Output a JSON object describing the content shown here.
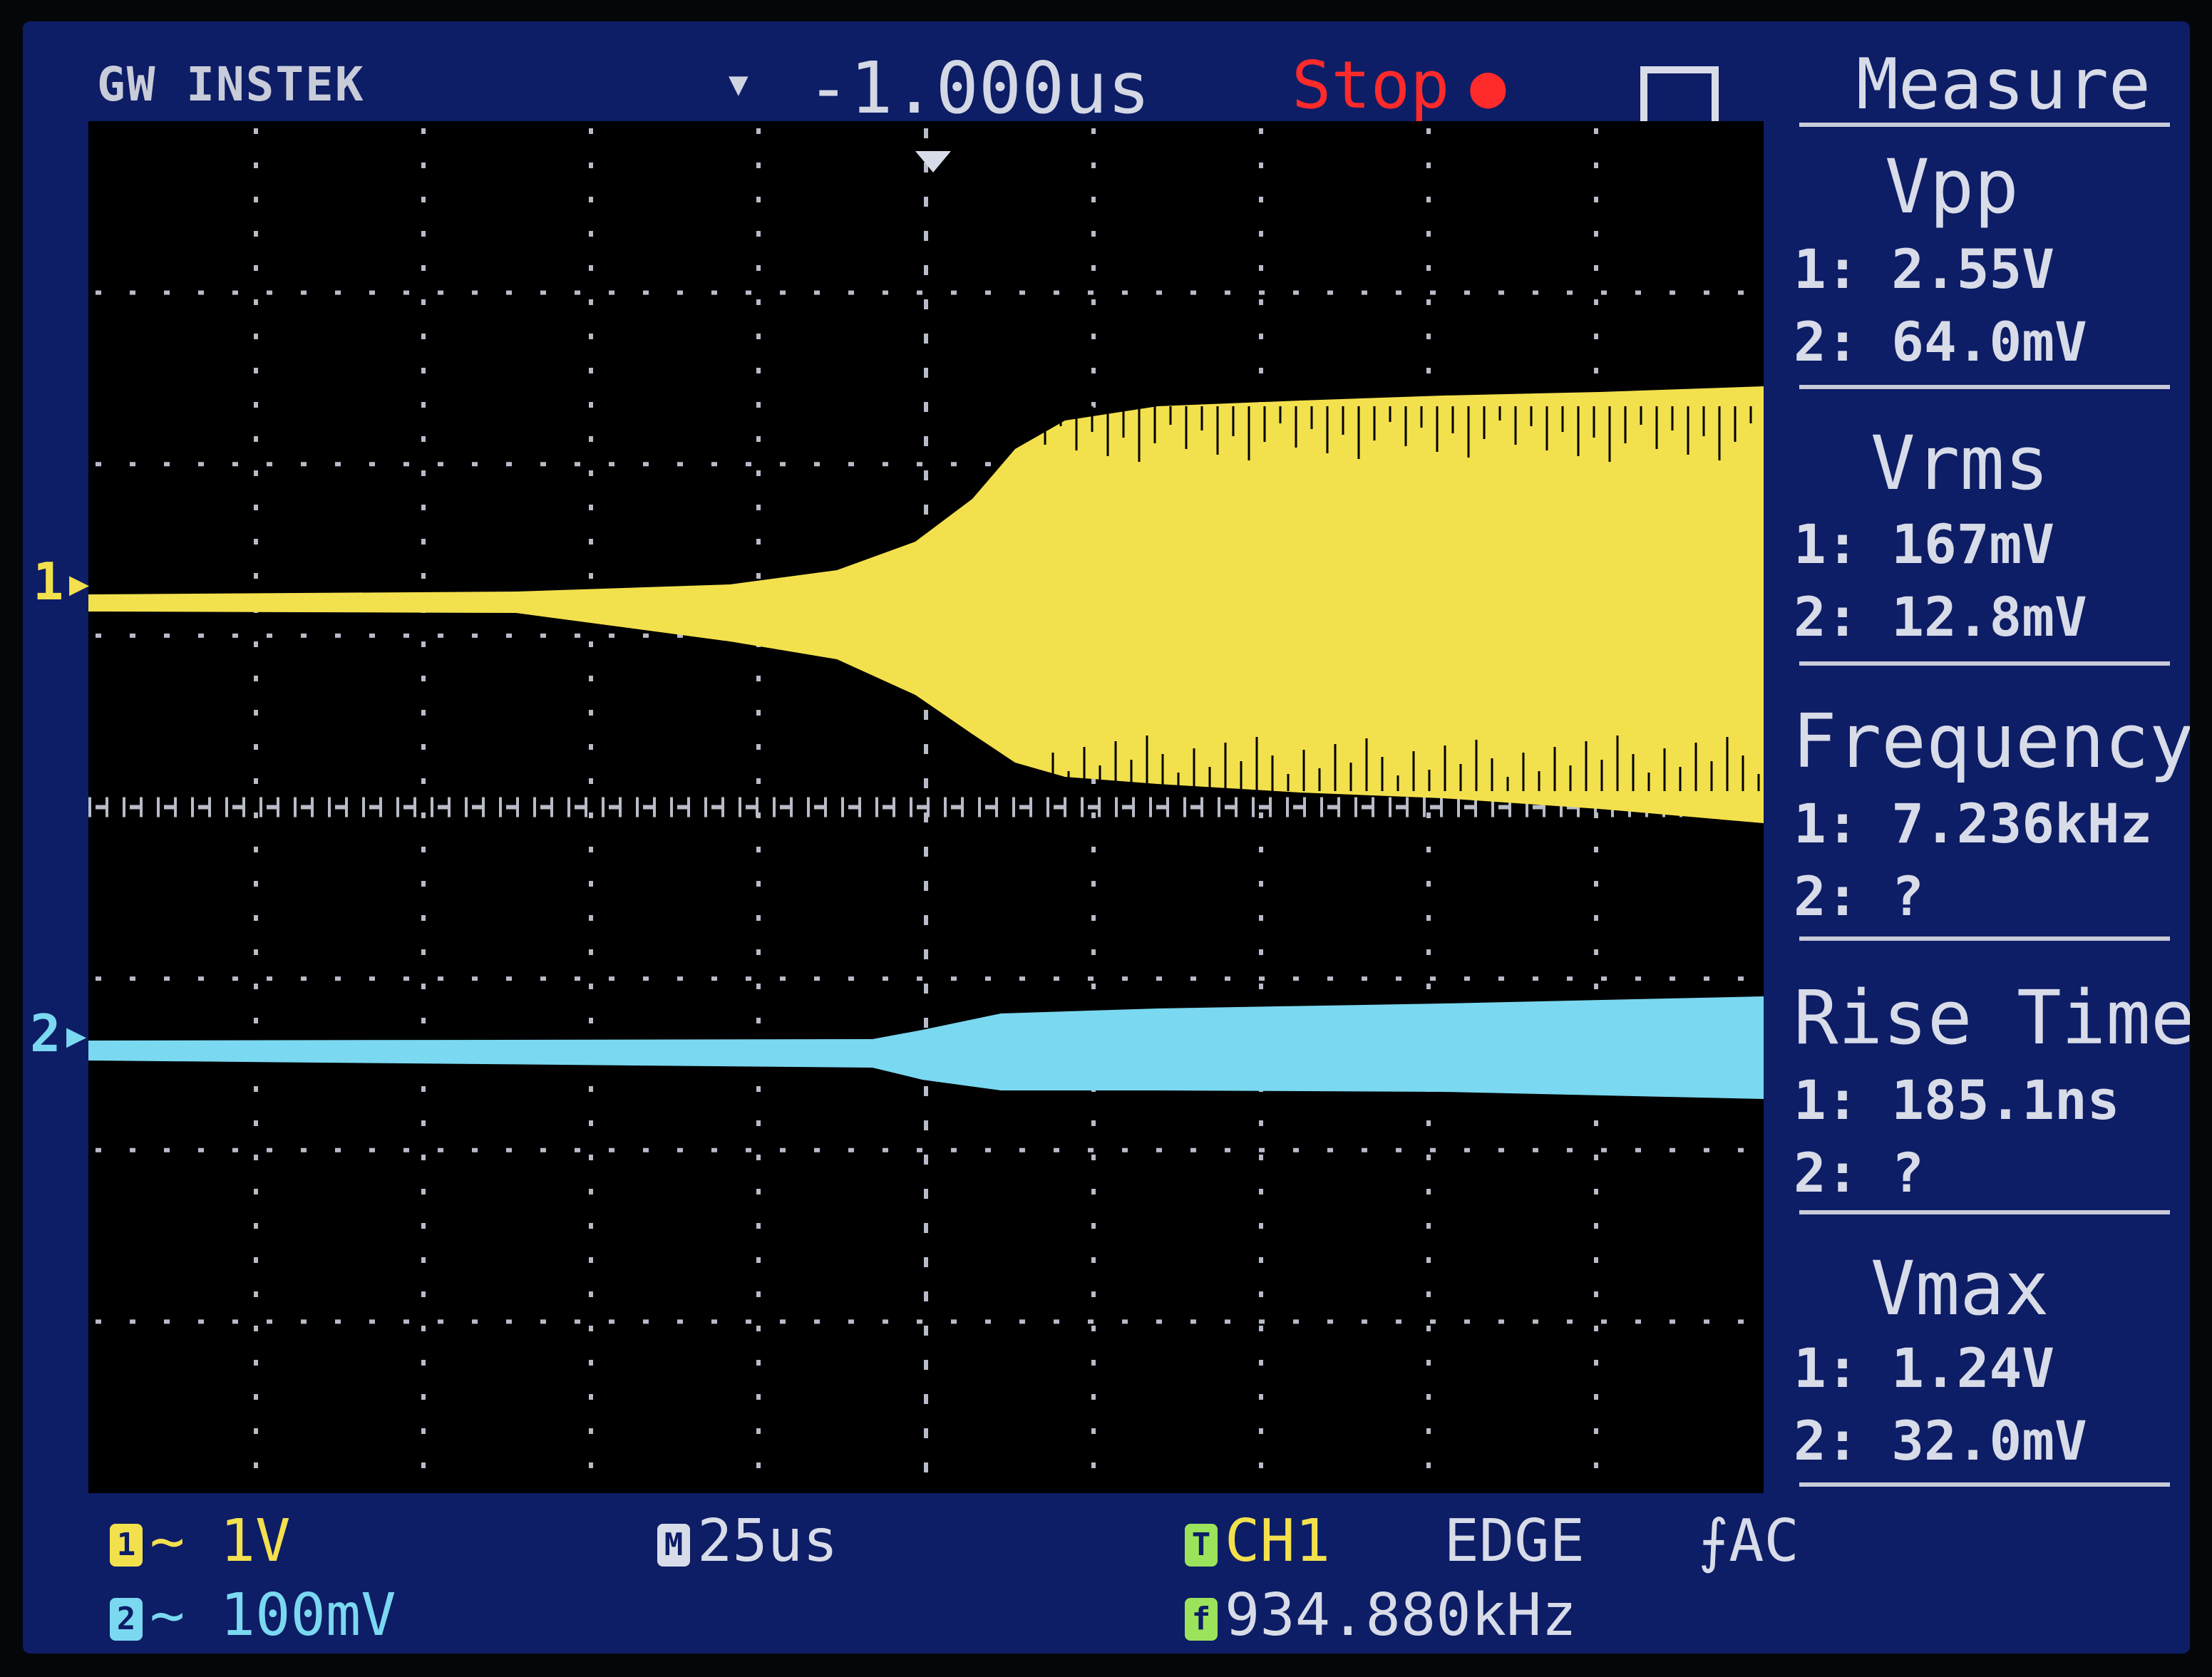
{
  "header": {
    "brand": "GW INSTEK",
    "trigger_position": "-1.000us",
    "run_state": "Stop",
    "trigger_shape_icon": "rising-pulse-icon",
    "trigger_marker_icon": "triangle-down-icon"
  },
  "channels": {
    "ch1_marker": "1",
    "ch2_marker": "2",
    "ch1_color": "#f3e04d",
    "ch2_color": "#7ad8f0"
  },
  "measure": {
    "title": "Measure",
    "items": [
      {
        "name": "Vpp",
        "ch1": "1: 2.55V",
        "ch2": "2: 64.0mV"
      },
      {
        "name": "Vrms",
        "ch1": "1: 167mV",
        "ch2": "2: 12.8mV"
      },
      {
        "name": "Frequency",
        "ch1": "1: 7.236kHz",
        "ch2": "2:   ?"
      },
      {
        "name": "Rise Time",
        "ch1": "1: 185.1ns",
        "ch2": "2:   ?"
      },
      {
        "name": "Vmax",
        "ch1": "1: 1.24V",
        "ch2": "2: 32.0mV"
      }
    ]
  },
  "status": {
    "ch1_badge": "1",
    "ch1_coupling_icon": "ac-coupling-icon",
    "ch1_scale": "1V",
    "ch2_badge": "2",
    "ch2_scale": "100mV",
    "timebase_badge": "M",
    "timebase": "25us",
    "trigger_badge": "T",
    "trigger_source": "CH1",
    "trigger_type": "EDGE",
    "trigger_slope_icon": "rising-edge-icon",
    "trigger_coupling": "AC",
    "freq_badge": "f",
    "trigger_frequency": "934.880kHz"
  },
  "colors": {
    "screen_bg": "#0d1d66",
    "ch1": "#f3e04d",
    "ch2": "#7ad8f0",
    "stop": "#ff2a2a",
    "trigger_label": "#9be35a"
  }
}
